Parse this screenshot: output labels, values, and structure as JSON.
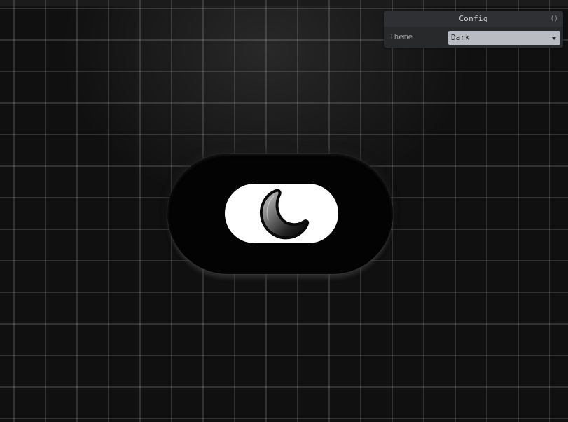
{
  "config_panel": {
    "title": "Config",
    "collapse_icon": "collapse-icon",
    "collapse_glyph": "()",
    "theme_label": "Theme",
    "theme_value": "Dark",
    "theme_caret_icon": "caret-down-icon"
  },
  "toggle": {
    "state": "dark",
    "icon": "moon-icon"
  },
  "colors": {
    "background": "#101010",
    "grid_line": "#4a4a4a",
    "panel_background": "#28292b",
    "select_background": "#b9bcc2",
    "toggle_outer": "#030303",
    "toggle_track": "#ffffff"
  }
}
